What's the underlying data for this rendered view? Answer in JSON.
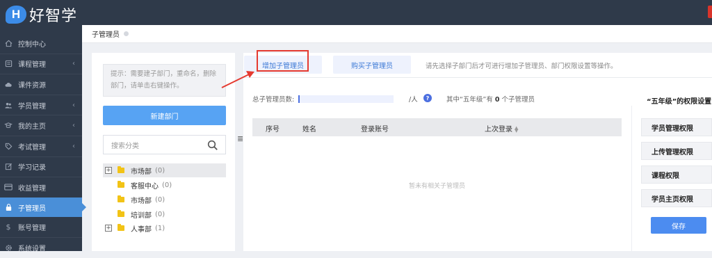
{
  "app": {
    "logo_letter": "H",
    "logo_text": "好智学"
  },
  "sidebar": {
    "items": [
      {
        "label": "控制中心",
        "icon": "home-icon",
        "arrow": false,
        "active": false
      },
      {
        "label": "课程管理",
        "icon": "book-icon",
        "arrow": true,
        "active": false
      },
      {
        "label": "课件资源",
        "icon": "cloud-icon",
        "arrow": false,
        "active": false
      },
      {
        "label": "学员管理",
        "icon": "users-icon",
        "arrow": true,
        "active": false
      },
      {
        "label": "我的主页",
        "icon": "flag-icon",
        "arrow": true,
        "active": false
      },
      {
        "label": "考试管理",
        "icon": "tag-icon",
        "arrow": true,
        "active": false
      },
      {
        "label": "学习记录",
        "icon": "edit-icon",
        "arrow": false,
        "active": false
      },
      {
        "label": "收益管理",
        "icon": "card-icon",
        "arrow": false,
        "active": false
      },
      {
        "label": "子管理员",
        "icon": "lock-icon",
        "arrow": false,
        "active": true
      },
      {
        "label": "账号管理",
        "icon": "dollar-icon",
        "arrow": false,
        "active": false
      },
      {
        "label": "系统设置",
        "icon": "gear-icon",
        "arrow": false,
        "active": false
      }
    ]
  },
  "breadcrumb": {
    "label": "子管理员"
  },
  "left": {
    "hint": "提示：需要建子部门，重命名，删除部门，请单击右键操作。",
    "new_dept": "新建部门",
    "search_placeholder": "搜索分类",
    "tree": [
      {
        "name": "市场部",
        "count": "(0)",
        "level": 0,
        "expandable": true,
        "selected": true
      },
      {
        "name": "客服中心",
        "count": "(0)",
        "level": 1,
        "expandable": false,
        "selected": false
      },
      {
        "name": "市场部",
        "count": "(0)",
        "level": 1,
        "expandable": false,
        "selected": false
      },
      {
        "name": "培训部",
        "count": "(0)",
        "level": 1,
        "expandable": false,
        "selected": false
      },
      {
        "name": "人事部",
        "count": "(1)",
        "level": 0,
        "expandable": true,
        "selected": false
      }
    ]
  },
  "tabs": {
    "add": "增加子管理员",
    "buy": "购买子管理员",
    "info": "请先选择子部门后才可进行增加子管理员、部门权限设置等操作。"
  },
  "stats": {
    "total_label": "总子管理员数:",
    "unit": "/人",
    "help": "?",
    "among_prefix": "其中“五年级”有",
    "among_count": "0",
    "among_suffix": "个子管理员"
  },
  "table": {
    "headers": [
      "序号",
      "姓名",
      "登录账号",
      "上次登录"
    ],
    "empty_text": "暂未有相关子管理员"
  },
  "permissions": {
    "title": "“五年级”的权限设置",
    "items": [
      "学员管理权限",
      "上传管理权限",
      "课程权限",
      "学员主页权限"
    ],
    "save": "保存"
  },
  "colors": {
    "sidebar_bg": "#2f3a4a",
    "accent": "#4a8fd8",
    "highlight_box": "#e53a30"
  }
}
